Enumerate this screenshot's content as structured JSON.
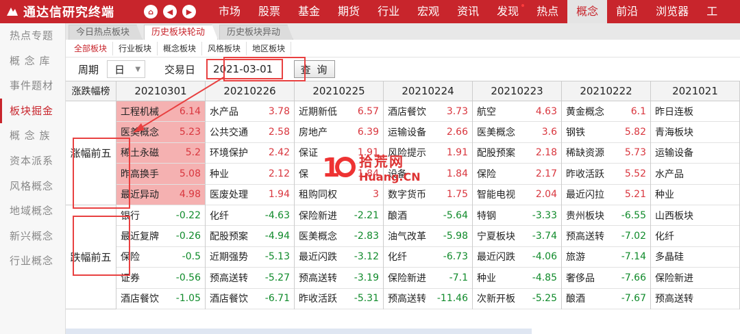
{
  "app": {
    "title": "通达信研究终端"
  },
  "nav_buttons": [
    "home-icon",
    "back-icon",
    "forward-icon"
  ],
  "menu": [
    {
      "label": "市场",
      "active": false,
      "dot": false
    },
    {
      "label": "股票",
      "active": false,
      "dot": false
    },
    {
      "label": "基金",
      "active": false,
      "dot": false
    },
    {
      "label": "期货",
      "active": false,
      "dot": false
    },
    {
      "label": "行业",
      "active": false,
      "dot": false
    },
    {
      "label": "宏观",
      "active": false,
      "dot": false
    },
    {
      "label": "资讯",
      "active": false,
      "dot": false
    },
    {
      "label": "发现",
      "active": false,
      "dot": true
    },
    {
      "label": "热点",
      "active": false,
      "dot": false
    },
    {
      "label": "概念",
      "active": true,
      "dot": false
    },
    {
      "label": "前沿",
      "active": false,
      "dot": false
    },
    {
      "label": "浏览器",
      "active": false,
      "dot": false
    },
    {
      "label": "工",
      "active": false,
      "dot": false
    }
  ],
  "sidebar": [
    {
      "label": "热点专题",
      "active": false
    },
    {
      "label": "概 念 库",
      "active": false
    },
    {
      "label": "事件题材",
      "active": false
    },
    {
      "label": "板块掘金",
      "active": true
    },
    {
      "label": "概 念 族",
      "active": false
    },
    {
      "label": "资本派系",
      "active": false
    },
    {
      "label": "风格概念",
      "active": false
    },
    {
      "label": "地域概念",
      "active": false
    },
    {
      "label": "新兴概念",
      "active": false
    },
    {
      "label": "行业概念",
      "active": false
    }
  ],
  "tabs": [
    {
      "label": "今日热点板块",
      "active": false
    },
    {
      "label": "历史板块轮动",
      "active": true
    },
    {
      "label": "历史板块异动",
      "active": false
    }
  ],
  "subtabs": [
    {
      "label": "全部板块",
      "active": true
    },
    {
      "label": "行业板块",
      "active": false
    },
    {
      "label": "概念板块",
      "active": false
    },
    {
      "label": "风格板块",
      "active": false
    },
    {
      "label": "地区板块",
      "active": false
    }
  ],
  "filters": {
    "period_label": "周期",
    "period_value": "日",
    "date_label": "交易日",
    "date_value": "2021-03-01",
    "query_button": "查 询"
  },
  "table": {
    "corner_header": "涨跌幅榜",
    "groups": [
      "涨幅前五",
      "跌幅前五"
    ],
    "dates": [
      "20210301",
      "20210226",
      "20210225",
      "20210224",
      "20210223",
      "20210222",
      "2021021"
    ],
    "columns": [
      [
        [
          "工程机械",
          "6.14"
        ],
        [
          "医美概念",
          "5.23"
        ],
        [
          "稀土永磁",
          "5.2"
        ],
        [
          "昨高换手",
          "5.08"
        ],
        [
          "最近异动",
          "4.98"
        ],
        [
          "银行",
          "-0.22"
        ],
        [
          "最近复牌",
          "-0.26"
        ],
        [
          "保险",
          "-0.5"
        ],
        [
          "证券",
          "-0.56"
        ],
        [
          "酒店餐饮",
          "-1.05"
        ]
      ],
      [
        [
          "水产品",
          "3.78"
        ],
        [
          "公共交通",
          "2.58"
        ],
        [
          "环境保护",
          "2.42"
        ],
        [
          "种业",
          "2.12"
        ],
        [
          "医废处理",
          "1.94"
        ],
        [
          "化纤",
          "-4.63"
        ],
        [
          "配股预案",
          "-4.94"
        ],
        [
          "近期强势",
          "-5.13"
        ],
        [
          "预高送转",
          "-5.27"
        ],
        [
          "酒店餐饮",
          "-6.71"
        ]
      ],
      [
        [
          "近期新低",
          "6.57"
        ],
        [
          "房地产",
          "6.39"
        ],
        [
          "保证",
          "1.91"
        ],
        [
          "保",
          "1.84"
        ],
        [
          "租购同权",
          "3"
        ],
        [
          "保险新进",
          "-2.21"
        ],
        [
          "医美概念",
          "-2.83"
        ],
        [
          "最近闪跌",
          "-3.12"
        ],
        [
          "预高送转",
          "-3.19"
        ],
        [
          "昨收活跃",
          "-5.31"
        ]
      ],
      [
        [
          "酒店餐饮",
          "3.73"
        ],
        [
          "运输设备",
          "2.66"
        ],
        [
          "风险提示",
          "1.91"
        ],
        [
          "设备",
          "1.84"
        ],
        [
          "数字货币",
          "1.75"
        ],
        [
          "酿酒",
          "-5.64"
        ],
        [
          "油气改革",
          "-5.98"
        ],
        [
          "化纤",
          "-6.73"
        ],
        [
          "保险新进",
          "-7.1"
        ],
        [
          "预高送转",
          "-11.46"
        ]
      ],
      [
        [
          "航空",
          "4.63"
        ],
        [
          "医美概念",
          "3.6"
        ],
        [
          "配股预案",
          "2.18"
        ],
        [
          "保险",
          "2.17"
        ],
        [
          "智能电视",
          "2.04"
        ],
        [
          "特钢",
          "-3.33"
        ],
        [
          "宁夏板块",
          "-3.74"
        ],
        [
          "最近闪跌",
          "-4.06"
        ],
        [
          "种业",
          "-4.85"
        ],
        [
          "次新开板",
          "-5.25"
        ]
      ],
      [
        [
          "黄金概念",
          "6.1"
        ],
        [
          "钢铁",
          "5.82"
        ],
        [
          "稀缺资源",
          "5.73"
        ],
        [
          "昨收活跃",
          "5.52"
        ],
        [
          "最近闪拉",
          "5.21"
        ],
        [
          "贵州板块",
          "-6.55"
        ],
        [
          "预高送转",
          "-7.02"
        ],
        [
          "旅游",
          "-7.14"
        ],
        [
          "奢侈品",
          "-7.66"
        ],
        [
          "酿酒",
          "-7.67"
        ]
      ],
      [
        [
          "昨日连板",
          ""
        ],
        [
          "青海板块",
          ""
        ],
        [
          "运输设备",
          ""
        ],
        [
          "水产品",
          ""
        ],
        [
          "种业",
          ""
        ],
        [
          "山西板块",
          ""
        ],
        [
          "化纤",
          ""
        ],
        [
          "多晶硅",
          ""
        ],
        [
          "保险新进",
          ""
        ],
        [
          "预高送转",
          ""
        ]
      ]
    ],
    "highlight_cells": [
      [
        0,
        0
      ],
      [
        0,
        1
      ],
      [
        0,
        2
      ],
      [
        0,
        3
      ],
      [
        0,
        4
      ]
    ]
  },
  "watermark": {
    "line1": "拾荒网",
    "line2": "Huang.CN"
  },
  "colors": {
    "brand": "#c8252c",
    "up": "#d9363e",
    "down": "#0f8a2a",
    "highlight": "#f5b1b1",
    "annotation": "#e84040"
  }
}
